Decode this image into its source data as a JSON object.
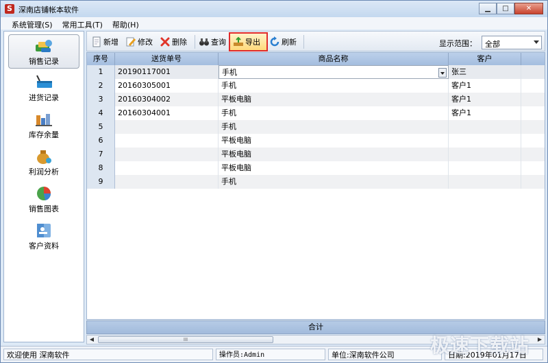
{
  "window": {
    "title": "深南店铺帐本软件",
    "icon_letter": "S",
    "minimize": "▁",
    "maximize": "□",
    "close": "✕"
  },
  "menu": [
    "系统管理(S)",
    "常用工具(T)",
    "帮助(H)"
  ],
  "nav": [
    {
      "label": "销售记录",
      "icon": "sales-icon",
      "active": true
    },
    {
      "label": "进货记录",
      "icon": "purchase-basket-icon"
    },
    {
      "label": "库存余量",
      "icon": "inventory-icon"
    },
    {
      "label": "利润分析",
      "icon": "profit-bag-icon"
    },
    {
      "label": "销售图表",
      "icon": "pie-chart-icon"
    },
    {
      "label": "客户资料",
      "icon": "customer-profile-icon"
    }
  ],
  "toolbar": {
    "add": "新增",
    "edit": "修改",
    "delete": "删除",
    "query": "查询",
    "export": "导出",
    "refresh": "刷新",
    "range_label": "显示范围：",
    "range_value": "全部"
  },
  "grid": {
    "columns": [
      "序号",
      "送货单号",
      "商品名称",
      "客户"
    ],
    "rows": [
      {
        "idx": "1",
        "order": "20190117001",
        "product": "手机",
        "customer": "张三"
      },
      {
        "idx": "2",
        "order": "20160305001",
        "product": "手机",
        "customer": "客户1"
      },
      {
        "idx": "3",
        "order": "20160304002",
        "product": "平板电脑",
        "customer": "客户1"
      },
      {
        "idx": "4",
        "order": "20160304001",
        "product": "手机",
        "customer": "客户1"
      },
      {
        "idx": "5",
        "order": "",
        "product": "手机",
        "customer": ""
      },
      {
        "idx": "6",
        "order": "",
        "product": "平板电脑",
        "customer": ""
      },
      {
        "idx": "7",
        "order": "",
        "product": "平板电脑",
        "customer": ""
      },
      {
        "idx": "8",
        "order": "",
        "product": "平板电脑",
        "customer": ""
      },
      {
        "idx": "9",
        "order": "",
        "product": "手机",
        "customer": ""
      }
    ],
    "total_label": "合计",
    "scroll_grip": "III"
  },
  "status": {
    "welcome": "欢迎使用 深南软件",
    "operator": "操作员:Admin",
    "unit": "单位:深南软件公司",
    "date": "日期:2019年01月17日"
  },
  "watermark": "极速下载站"
}
